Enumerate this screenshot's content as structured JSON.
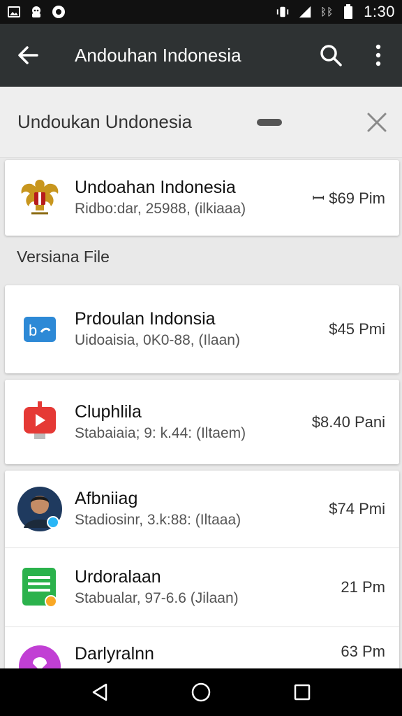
{
  "status_bar": {
    "icons_left": [
      "image-icon",
      "face-icon",
      "media-icon"
    ],
    "icons_right": [
      "vibrate-icon",
      "signal-icon",
      "network-label",
      "battery-icon"
    ],
    "network_label": "ᛒᛒ",
    "time": "1:30"
  },
  "app_bar": {
    "title": "Andouhan Indonesia",
    "back_icon": "arrow-back-icon",
    "search_icon": "search-icon",
    "menu_icon": "more-vert-icon"
  },
  "search": {
    "query": "Undoukan Undonesia",
    "clear_icon": "close-icon"
  },
  "top_item": {
    "name": "Undoahan Indonesia",
    "sub": "Ridbo:dar, 25988, (ilkiaaa)",
    "price": "ꟷ $69 Pim",
    "icon": "garuda-emblem-icon"
  },
  "section_label": "Versiana File",
  "items": [
    {
      "name": "Prdoulan Indonsia",
      "sub": "Uidoaisia, 0K0-88, (Ilaan)",
      "price": "$45 Pmi",
      "icon": "bc-app-icon"
    },
    {
      "name": "Cluphlila",
      "sub": "Stabaiaia; 9: k.44: (Iltaem)",
      "price": "$8.40 Pani",
      "icon": "youtube-icon"
    },
    {
      "name": "Afbniiag",
      "sub": "Stadiosinr, 3.k:88: (Iltaaa)",
      "price": "$74 Pmi",
      "icon": "avatar"
    },
    {
      "name": "Urdoralaan",
      "sub": "Stabualar, 97-6.6 (Jilaan)",
      "price": "21 Pm",
      "icon": "sheets-app-icon"
    },
    {
      "name": "Darlyralnn",
      "sub": "",
      "price": "63 Pm",
      "icon": "purple-app-icon"
    }
  ],
  "colors": {
    "app_bar": "#2e3233",
    "status_bar": "#111111",
    "background": "#e9e9e9",
    "youtube_red": "#e53935",
    "sheets_green": "#2bb24c",
    "bc_blue": "#2d89d6"
  },
  "nav_bar": [
    "back-nav-icon",
    "home-nav-icon",
    "recents-nav-icon"
  ]
}
